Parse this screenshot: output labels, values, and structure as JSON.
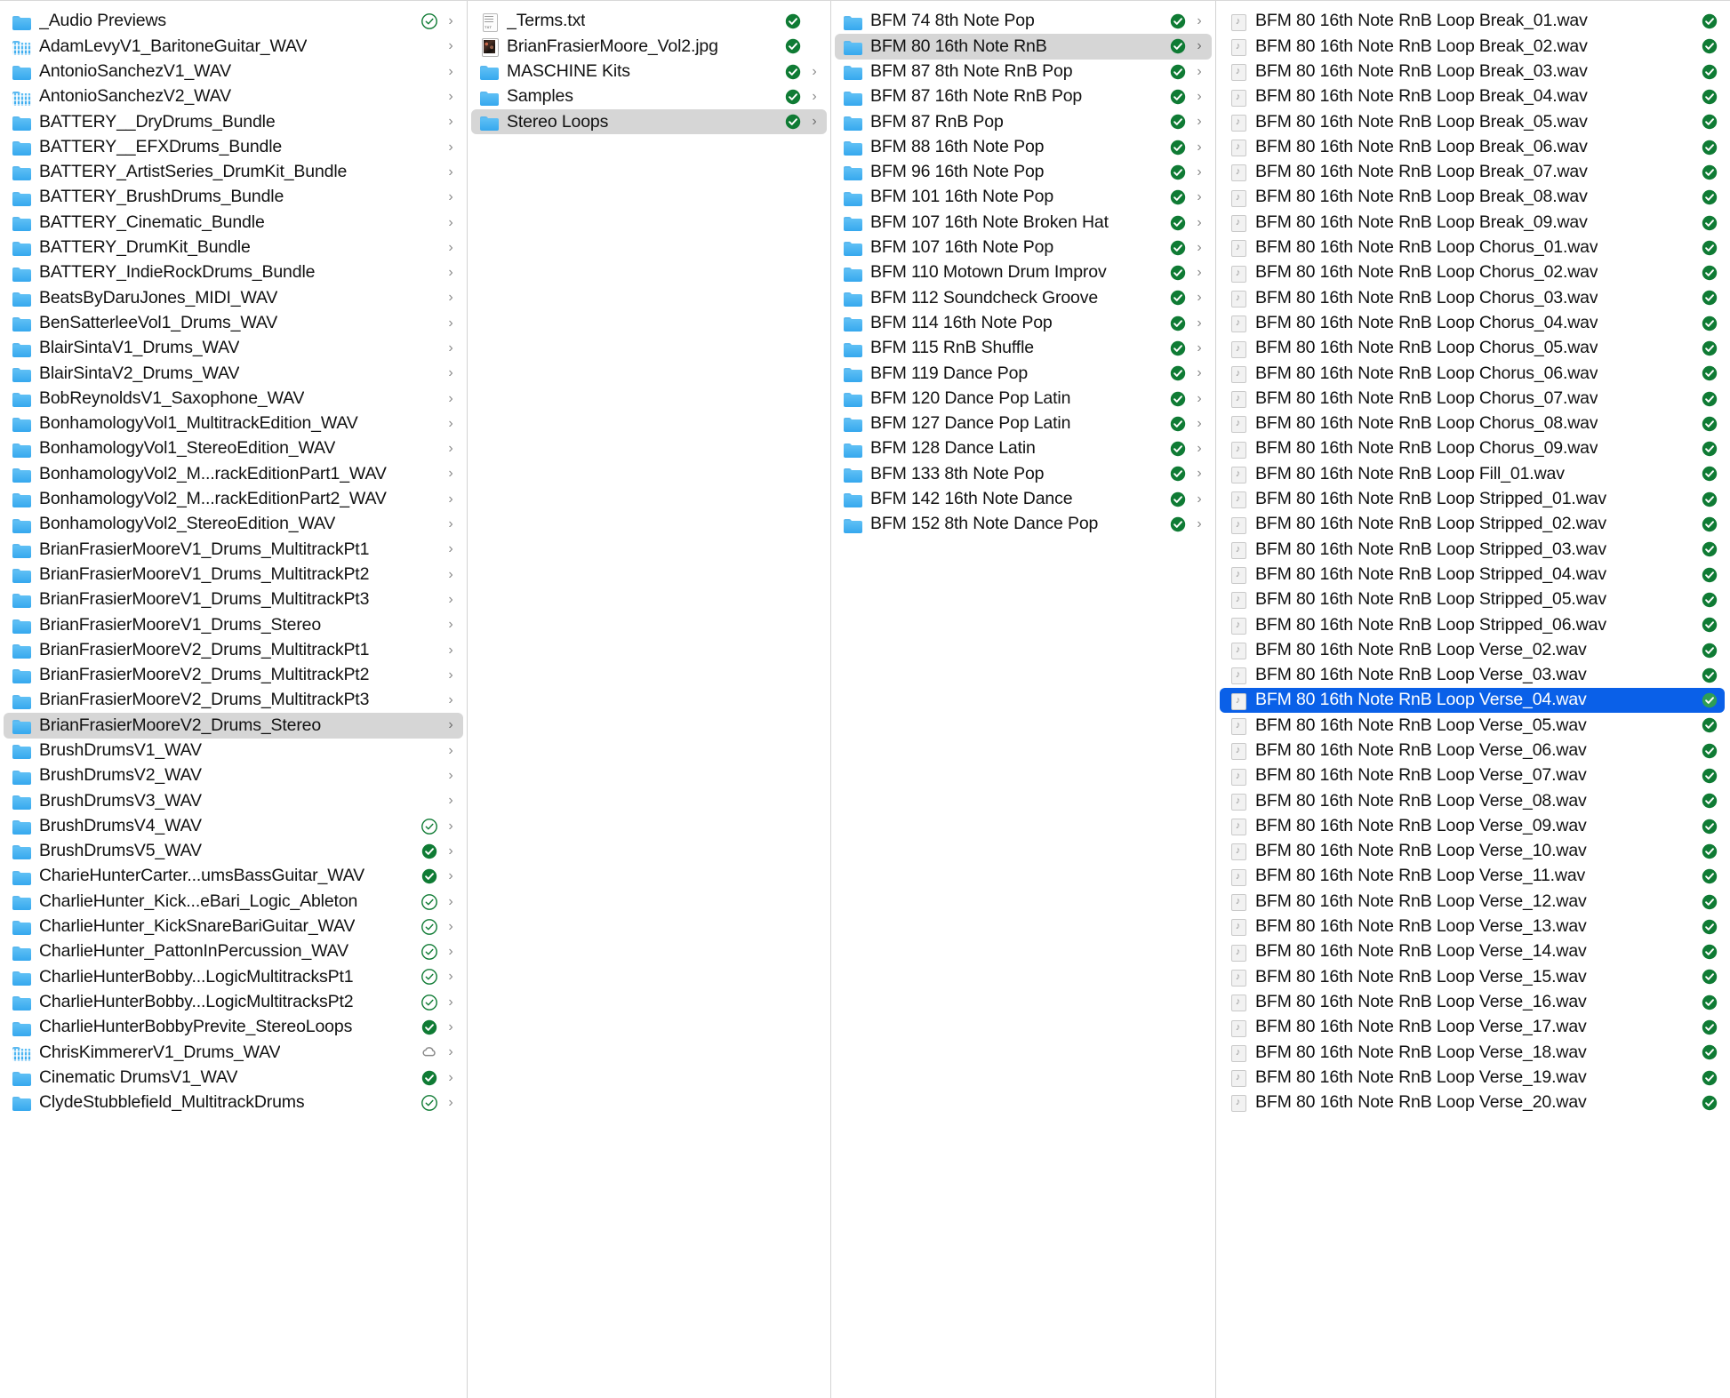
{
  "app": {
    "name": "Finder",
    "view": "column-view",
    "selection_color": "#0a60e8",
    "highlight_color": "#d6d6d6",
    "badge_filled_color": "#0f7b34",
    "badge_outline_color": "#0f7b34",
    "badge_cloud_color": "#8a8a8a",
    "folder_color": "#3ca9ef"
  },
  "columns": [
    {
      "name": "column-1-libraries",
      "items": [
        {
          "label": "_Audio Previews",
          "icon": "folder",
          "status": "check-outline",
          "chevron": true
        },
        {
          "label": "AdamLevyV1_BaritoneGuitar_WAV",
          "icon": "folder-custom",
          "status": "none",
          "chevron": true
        },
        {
          "label": "AntonioSanchezV1_WAV",
          "icon": "folder",
          "status": "none",
          "chevron": true
        },
        {
          "label": "AntonioSanchezV2_WAV",
          "icon": "folder-custom",
          "status": "none",
          "chevron": true
        },
        {
          "label": "BATTERY__DryDrums_Bundle",
          "icon": "folder",
          "status": "none",
          "chevron": true
        },
        {
          "label": "BATTERY__EFXDrums_Bundle",
          "icon": "folder",
          "status": "none",
          "chevron": true
        },
        {
          "label": "BATTERY_ArtistSeries_DrumKit_Bundle",
          "icon": "folder",
          "status": "none",
          "chevron": true
        },
        {
          "label": "BATTERY_BrushDrums_Bundle",
          "icon": "folder",
          "status": "none",
          "chevron": true
        },
        {
          "label": "BATTERY_Cinematic_Bundle",
          "icon": "folder",
          "status": "none",
          "chevron": true
        },
        {
          "label": "BATTERY_DrumKit_Bundle",
          "icon": "folder",
          "status": "none",
          "chevron": true
        },
        {
          "label": "BATTERY_IndieRockDrums_Bundle",
          "icon": "folder",
          "status": "none",
          "chevron": true
        },
        {
          "label": "BeatsByDaruJones_MIDI_WAV",
          "icon": "folder",
          "status": "none",
          "chevron": true
        },
        {
          "label": "BenSatterleeVol1_Drums_WAV",
          "icon": "folder",
          "status": "none",
          "chevron": true
        },
        {
          "label": "BlairSintaV1_Drums_WAV",
          "icon": "folder",
          "status": "none",
          "chevron": true
        },
        {
          "label": "BlairSintaV2_Drums_WAV",
          "icon": "folder",
          "status": "none",
          "chevron": true
        },
        {
          "label": "BobReynoldsV1_Saxophone_WAV",
          "icon": "folder",
          "status": "none",
          "chevron": true
        },
        {
          "label": "BonhamologyVol1_MultitrackEdition_WAV",
          "icon": "folder",
          "status": "none",
          "chevron": true
        },
        {
          "label": "BonhamologyVol1_StereoEdition_WAV",
          "icon": "folder",
          "status": "none",
          "chevron": true
        },
        {
          "label": "BonhamologyVol2_M...rackEditionPart1_WAV",
          "icon": "folder",
          "status": "none",
          "chevron": true
        },
        {
          "label": "BonhamologyVol2_M...rackEditionPart2_WAV",
          "icon": "folder",
          "status": "none",
          "chevron": true
        },
        {
          "label": "BonhamologyVol2_StereoEdition_WAV",
          "icon": "folder",
          "status": "none",
          "chevron": true
        },
        {
          "label": "BrianFrasierMooreV1_Drums_MultitrackPt1",
          "icon": "folder",
          "status": "none",
          "chevron": true
        },
        {
          "label": "BrianFrasierMooreV1_Drums_MultitrackPt2",
          "icon": "folder",
          "status": "none",
          "chevron": true
        },
        {
          "label": "BrianFrasierMooreV1_Drums_MultitrackPt3",
          "icon": "folder",
          "status": "none",
          "chevron": true
        },
        {
          "label": "BrianFrasierMooreV1_Drums_Stereo",
          "icon": "folder",
          "status": "none",
          "chevron": true
        },
        {
          "label": "BrianFrasierMooreV2_Drums_MultitrackPt1",
          "icon": "folder",
          "status": "none",
          "chevron": true
        },
        {
          "label": "BrianFrasierMooreV2_Drums_MultitrackPt2",
          "icon": "folder",
          "status": "none",
          "chevron": true
        },
        {
          "label": "BrianFrasierMooreV2_Drums_MultitrackPt3",
          "icon": "folder",
          "status": "none",
          "chevron": true
        },
        {
          "label": "BrianFrasierMooreV2_Drums_Stereo",
          "icon": "folder",
          "status": "none",
          "chevron": true,
          "selected": "gray"
        },
        {
          "label": "BrushDrumsV1_WAV",
          "icon": "folder",
          "status": "none",
          "chevron": true
        },
        {
          "label": "BrushDrumsV2_WAV",
          "icon": "folder",
          "status": "none",
          "chevron": true
        },
        {
          "label": "BrushDrumsV3_WAV",
          "icon": "folder",
          "status": "none",
          "chevron": true
        },
        {
          "label": "BrushDrumsV4_WAV",
          "icon": "folder",
          "status": "check-outline",
          "chevron": true
        },
        {
          "label": "BrushDrumsV5_WAV",
          "icon": "folder",
          "status": "check-filled",
          "chevron": true
        },
        {
          "label": "CharieHunterCarter...umsBassGuitar_WAV",
          "icon": "folder",
          "status": "check-filled",
          "chevron": true
        },
        {
          "label": "CharlieHunter_Kick...eBari_Logic_Ableton",
          "icon": "folder",
          "status": "check-outline",
          "chevron": true
        },
        {
          "label": "CharlieHunter_KickSnareBariGuitar_WAV",
          "icon": "folder",
          "status": "check-outline",
          "chevron": true
        },
        {
          "label": "CharlieHunter_PattonInPercussion_WAV",
          "icon": "folder",
          "status": "check-outline",
          "chevron": true
        },
        {
          "label": "CharlieHunterBobby...LogicMultitracksPt1",
          "icon": "folder",
          "status": "check-outline",
          "chevron": true
        },
        {
          "label": "CharlieHunterBobby...LogicMultitracksPt2",
          "icon": "folder",
          "status": "check-outline",
          "chevron": true
        },
        {
          "label": "CharlieHunterBobbyPrevite_StereoLoops",
          "icon": "folder",
          "status": "check-filled",
          "chevron": true
        },
        {
          "label": "ChrisKimmererV1_Drums_WAV",
          "icon": "folder-custom",
          "status": "cloud",
          "chevron": true
        },
        {
          "label": "Cinematic DrumsV1_WAV",
          "icon": "folder",
          "status": "check-filled",
          "chevron": true
        },
        {
          "label": "ClydeStubblefield_MultitrackDrums",
          "icon": "folder",
          "status": "check-outline",
          "chevron": true
        }
      ]
    },
    {
      "name": "column-2-package-contents",
      "items": [
        {
          "label": "_Terms.txt",
          "icon": "txt",
          "status": "check-filled",
          "chevron": false
        },
        {
          "label": "BrianFrasierMoore_Vol2.jpg",
          "icon": "jpg",
          "status": "check-filled",
          "chevron": false
        },
        {
          "label": "MASCHINE Kits",
          "icon": "folder",
          "status": "check-filled",
          "chevron": true
        },
        {
          "label": "Samples",
          "icon": "folder",
          "status": "check-filled",
          "chevron": true
        },
        {
          "label": "Stereo Loops",
          "icon": "folder",
          "status": "check-filled",
          "chevron": true,
          "selected": "gray"
        }
      ]
    },
    {
      "name": "column-3-stereo-loops",
      "items": [
        {
          "label": "BFM 74 8th Note Pop",
          "icon": "folder",
          "status": "check-filled",
          "chevron": true
        },
        {
          "label": "BFM 80 16th Note RnB",
          "icon": "folder",
          "status": "check-filled",
          "chevron": true,
          "selected": "gray"
        },
        {
          "label": "BFM 87 8th Note RnB Pop",
          "icon": "folder",
          "status": "check-filled",
          "chevron": true
        },
        {
          "label": "BFM 87 16th Note RnB Pop",
          "icon": "folder",
          "status": "check-filled",
          "chevron": true
        },
        {
          "label": "BFM 87 RnB Pop",
          "icon": "folder",
          "status": "check-filled",
          "chevron": true
        },
        {
          "label": "BFM 88 16th Note Pop",
          "icon": "folder",
          "status": "check-filled",
          "chevron": true
        },
        {
          "label": "BFM 96 16th Note Pop",
          "icon": "folder",
          "status": "check-filled",
          "chevron": true
        },
        {
          "label": "BFM 101 16th Note Pop",
          "icon": "folder",
          "status": "check-filled",
          "chevron": true
        },
        {
          "label": "BFM 107 16th Note Broken Hat",
          "icon": "folder",
          "status": "check-filled",
          "chevron": true
        },
        {
          "label": "BFM 107 16th Note Pop",
          "icon": "folder",
          "status": "check-filled",
          "chevron": true
        },
        {
          "label": "BFM 110 Motown Drum Improv",
          "icon": "folder",
          "status": "check-filled",
          "chevron": true
        },
        {
          "label": "BFM 112 Soundcheck Groove",
          "icon": "folder",
          "status": "check-filled",
          "chevron": true
        },
        {
          "label": "BFM 114 16th Note Pop",
          "icon": "folder",
          "status": "check-filled",
          "chevron": true
        },
        {
          "label": "BFM 115 RnB Shuffle",
          "icon": "folder",
          "status": "check-filled",
          "chevron": true
        },
        {
          "label": "BFM 119 Dance Pop",
          "icon": "folder",
          "status": "check-filled",
          "chevron": true
        },
        {
          "label": "BFM 120 Dance Pop Latin",
          "icon": "folder",
          "status": "check-filled",
          "chevron": true
        },
        {
          "label": "BFM 127 Dance Pop Latin",
          "icon": "folder",
          "status": "check-filled",
          "chevron": true
        },
        {
          "label": "BFM 128 Dance Latin",
          "icon": "folder",
          "status": "check-filled",
          "chevron": true
        },
        {
          "label": "BFM 133 8th Note Pop",
          "icon": "folder",
          "status": "check-filled",
          "chevron": true
        },
        {
          "label": "BFM 142 16th Note Dance",
          "icon": "folder",
          "status": "check-filled",
          "chevron": true
        },
        {
          "label": "BFM 152 8th Note Dance Pop",
          "icon": "folder",
          "status": "check-filled",
          "chevron": true
        }
      ]
    },
    {
      "name": "column-4-loop-files",
      "items": [
        {
          "label": "BFM 80 16th Note RnB Loop Break_01.wav",
          "icon": "audio",
          "status": "check-filled",
          "chevron": false
        },
        {
          "label": "BFM 80 16th Note RnB Loop Break_02.wav",
          "icon": "audio",
          "status": "check-filled",
          "chevron": false
        },
        {
          "label": "BFM 80 16th Note RnB Loop Break_03.wav",
          "icon": "audio",
          "status": "check-filled",
          "chevron": false
        },
        {
          "label": "BFM 80 16th Note RnB Loop Break_04.wav",
          "icon": "audio",
          "status": "check-filled",
          "chevron": false
        },
        {
          "label": "BFM 80 16th Note RnB Loop Break_05.wav",
          "icon": "audio",
          "status": "check-filled",
          "chevron": false
        },
        {
          "label": "BFM 80 16th Note RnB Loop Break_06.wav",
          "icon": "audio",
          "status": "check-filled",
          "chevron": false
        },
        {
          "label": "BFM 80 16th Note RnB Loop Break_07.wav",
          "icon": "audio",
          "status": "check-filled",
          "chevron": false
        },
        {
          "label": "BFM 80 16th Note RnB Loop Break_08.wav",
          "icon": "audio",
          "status": "check-filled",
          "chevron": false
        },
        {
          "label": "BFM 80 16th Note RnB Loop Break_09.wav",
          "icon": "audio",
          "status": "check-filled",
          "chevron": false
        },
        {
          "label": "BFM 80 16th Note RnB Loop Chorus_01.wav",
          "icon": "audio",
          "status": "check-filled",
          "chevron": false
        },
        {
          "label": "BFM 80 16th Note RnB Loop Chorus_02.wav",
          "icon": "audio",
          "status": "check-filled",
          "chevron": false
        },
        {
          "label": "BFM 80 16th Note RnB Loop Chorus_03.wav",
          "icon": "audio",
          "status": "check-filled",
          "chevron": false
        },
        {
          "label": "BFM 80 16th Note RnB Loop Chorus_04.wav",
          "icon": "audio",
          "status": "check-filled",
          "chevron": false
        },
        {
          "label": "BFM 80 16th Note RnB Loop Chorus_05.wav",
          "icon": "audio",
          "status": "check-filled",
          "chevron": false
        },
        {
          "label": "BFM 80 16th Note RnB Loop Chorus_06.wav",
          "icon": "audio",
          "status": "check-filled",
          "chevron": false
        },
        {
          "label": "BFM 80 16th Note RnB Loop Chorus_07.wav",
          "icon": "audio",
          "status": "check-filled",
          "chevron": false
        },
        {
          "label": "BFM 80 16th Note RnB Loop Chorus_08.wav",
          "icon": "audio",
          "status": "check-filled",
          "chevron": false
        },
        {
          "label": "BFM 80 16th Note RnB Loop Chorus_09.wav",
          "icon": "audio",
          "status": "check-filled",
          "chevron": false
        },
        {
          "label": "BFM 80 16th Note RnB Loop Fill_01.wav",
          "icon": "audio",
          "status": "check-filled",
          "chevron": false
        },
        {
          "label": "BFM 80 16th Note RnB Loop Stripped_01.wav",
          "icon": "audio",
          "status": "check-filled",
          "chevron": false
        },
        {
          "label": "BFM 80 16th Note RnB Loop Stripped_02.wav",
          "icon": "audio",
          "status": "check-filled",
          "chevron": false
        },
        {
          "label": "BFM 80 16th Note RnB Loop Stripped_03.wav",
          "icon": "audio",
          "status": "check-filled",
          "chevron": false
        },
        {
          "label": "BFM 80 16th Note RnB Loop Stripped_04.wav",
          "icon": "audio",
          "status": "check-filled",
          "chevron": false
        },
        {
          "label": "BFM 80 16th Note RnB Loop Stripped_05.wav",
          "icon": "audio",
          "status": "check-filled",
          "chevron": false
        },
        {
          "label": "BFM 80 16th Note RnB Loop Stripped_06.wav",
          "icon": "audio",
          "status": "check-filled",
          "chevron": false
        },
        {
          "label": "BFM 80 16th Note RnB Loop Verse_02.wav",
          "icon": "audio",
          "status": "check-filled",
          "chevron": false
        },
        {
          "label": "BFM 80 16th Note RnB Loop Verse_03.wav",
          "icon": "audio",
          "status": "check-filled",
          "chevron": false
        },
        {
          "label": "BFM 80 16th Note RnB Loop Verse_04.wav",
          "icon": "audio",
          "status": "check-filled",
          "chevron": false,
          "selected": "blue"
        },
        {
          "label": "BFM 80 16th Note RnB Loop Verse_05.wav",
          "icon": "audio",
          "status": "check-filled",
          "chevron": false
        },
        {
          "label": "BFM 80 16th Note RnB Loop Verse_06.wav",
          "icon": "audio",
          "status": "check-filled",
          "chevron": false
        },
        {
          "label": "BFM 80 16th Note RnB Loop Verse_07.wav",
          "icon": "audio",
          "status": "check-filled",
          "chevron": false
        },
        {
          "label": "BFM 80 16th Note RnB Loop Verse_08.wav",
          "icon": "audio",
          "status": "check-filled",
          "chevron": false
        },
        {
          "label": "BFM 80 16th Note RnB Loop Verse_09.wav",
          "icon": "audio",
          "status": "check-filled",
          "chevron": false
        },
        {
          "label": "BFM 80 16th Note RnB Loop Verse_10.wav",
          "icon": "audio",
          "status": "check-filled",
          "chevron": false
        },
        {
          "label": "BFM 80 16th Note RnB Loop Verse_11.wav",
          "icon": "audio",
          "status": "check-filled",
          "chevron": false
        },
        {
          "label": "BFM 80 16th Note RnB Loop Verse_12.wav",
          "icon": "audio",
          "status": "check-filled",
          "chevron": false
        },
        {
          "label": "BFM 80 16th Note RnB Loop Verse_13.wav",
          "icon": "audio",
          "status": "check-filled",
          "chevron": false
        },
        {
          "label": "BFM 80 16th Note RnB Loop Verse_14.wav",
          "icon": "audio",
          "status": "check-filled",
          "chevron": false
        },
        {
          "label": "BFM 80 16th Note RnB Loop Verse_15.wav",
          "icon": "audio",
          "status": "check-filled",
          "chevron": false
        },
        {
          "label": "BFM 80 16th Note RnB Loop Verse_16.wav",
          "icon": "audio",
          "status": "check-filled",
          "chevron": false
        },
        {
          "label": "BFM 80 16th Note RnB Loop Verse_17.wav",
          "icon": "audio",
          "status": "check-filled",
          "chevron": false
        },
        {
          "label": "BFM 80 16th Note RnB Loop Verse_18.wav",
          "icon": "audio",
          "status": "check-filled",
          "chevron": false
        },
        {
          "label": "BFM 80 16th Note RnB Loop Verse_19.wav",
          "icon": "audio",
          "status": "check-filled",
          "chevron": false
        },
        {
          "label": "BFM 80 16th Note RnB Loop Verse_20.wav",
          "icon": "audio",
          "status": "check-filled",
          "chevron": false
        }
      ]
    }
  ],
  "icons": {
    "folder": "folder-icon",
    "folder-custom": "folder-custom-icon",
    "txt": "text-document-icon",
    "jpg": "image-thumbnail-icon",
    "audio": "audio-file-icon",
    "check-filled": "downloaded-check-icon",
    "check-outline": "partially-downloaded-check-icon",
    "cloud": "icloud-download-icon",
    "chevron": "chevron-right-icon"
  }
}
